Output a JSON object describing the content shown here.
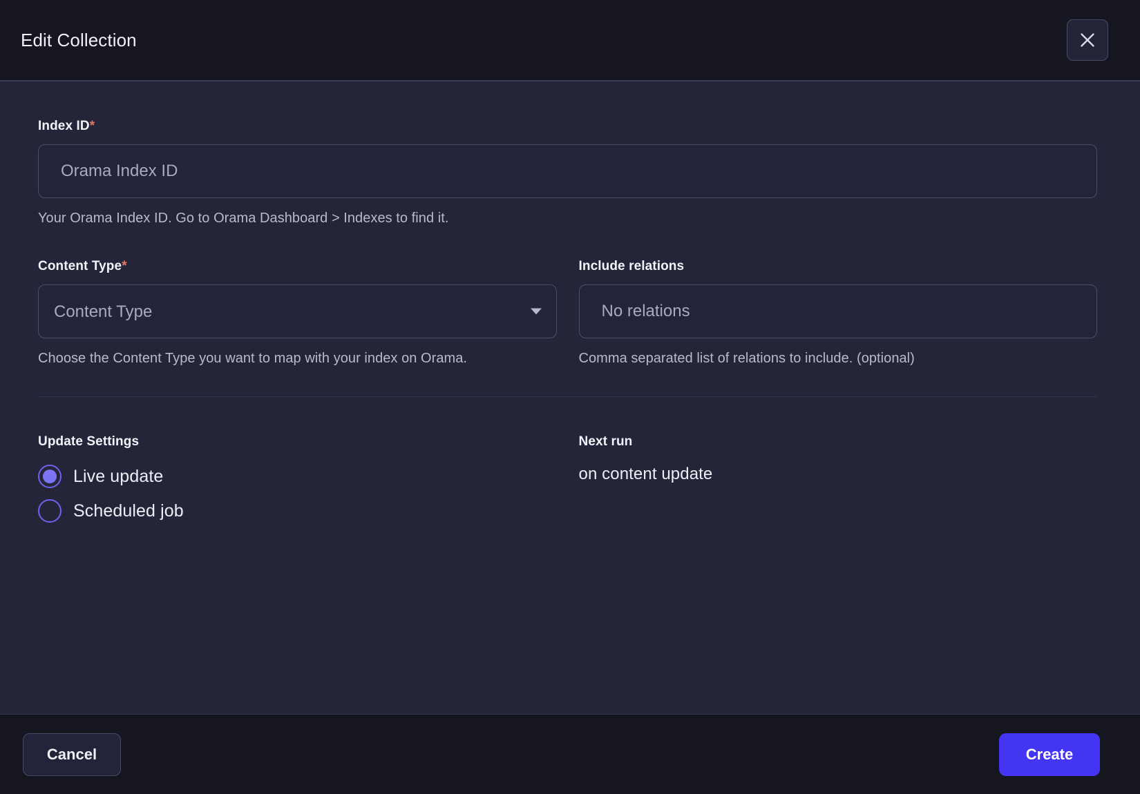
{
  "header": {
    "title": "Edit Collection",
    "close_icon": "close-icon"
  },
  "form": {
    "index_id": {
      "label": "Index ID",
      "required_marker": "*",
      "placeholder": "Orama Index ID",
      "value": "",
      "helper": "Your Orama Index ID. Go to Orama Dashboard > Indexes to find it."
    },
    "content_type": {
      "label": "Content Type",
      "required_marker": "*",
      "placeholder": "Content Type",
      "selected": "Content Type",
      "options": [
        "Content Type"
      ],
      "helper": "Choose the Content Type you want to map with your index on Orama.",
      "caret_icon": "chevron-down-icon"
    },
    "include_relations": {
      "label": "Include relations",
      "placeholder": "No relations",
      "value": "",
      "helper": "Comma separated list of relations to include. (optional)"
    }
  },
  "update_settings": {
    "label": "Update Settings",
    "options": [
      {
        "label": "Live update",
        "selected": true
      },
      {
        "label": "Scheduled job",
        "selected": false
      }
    ]
  },
  "next_run": {
    "label": "Next run",
    "value": "on content update"
  },
  "footer": {
    "cancel_label": "Cancel",
    "create_label": "Create"
  },
  "colors": {
    "accent": "#4335f2",
    "radio_accent": "#7c74f5",
    "required_star": "#e8776b",
    "header_bg": "#15161f",
    "body_bg": "#242539",
    "input_border": "#4d4e6c"
  }
}
